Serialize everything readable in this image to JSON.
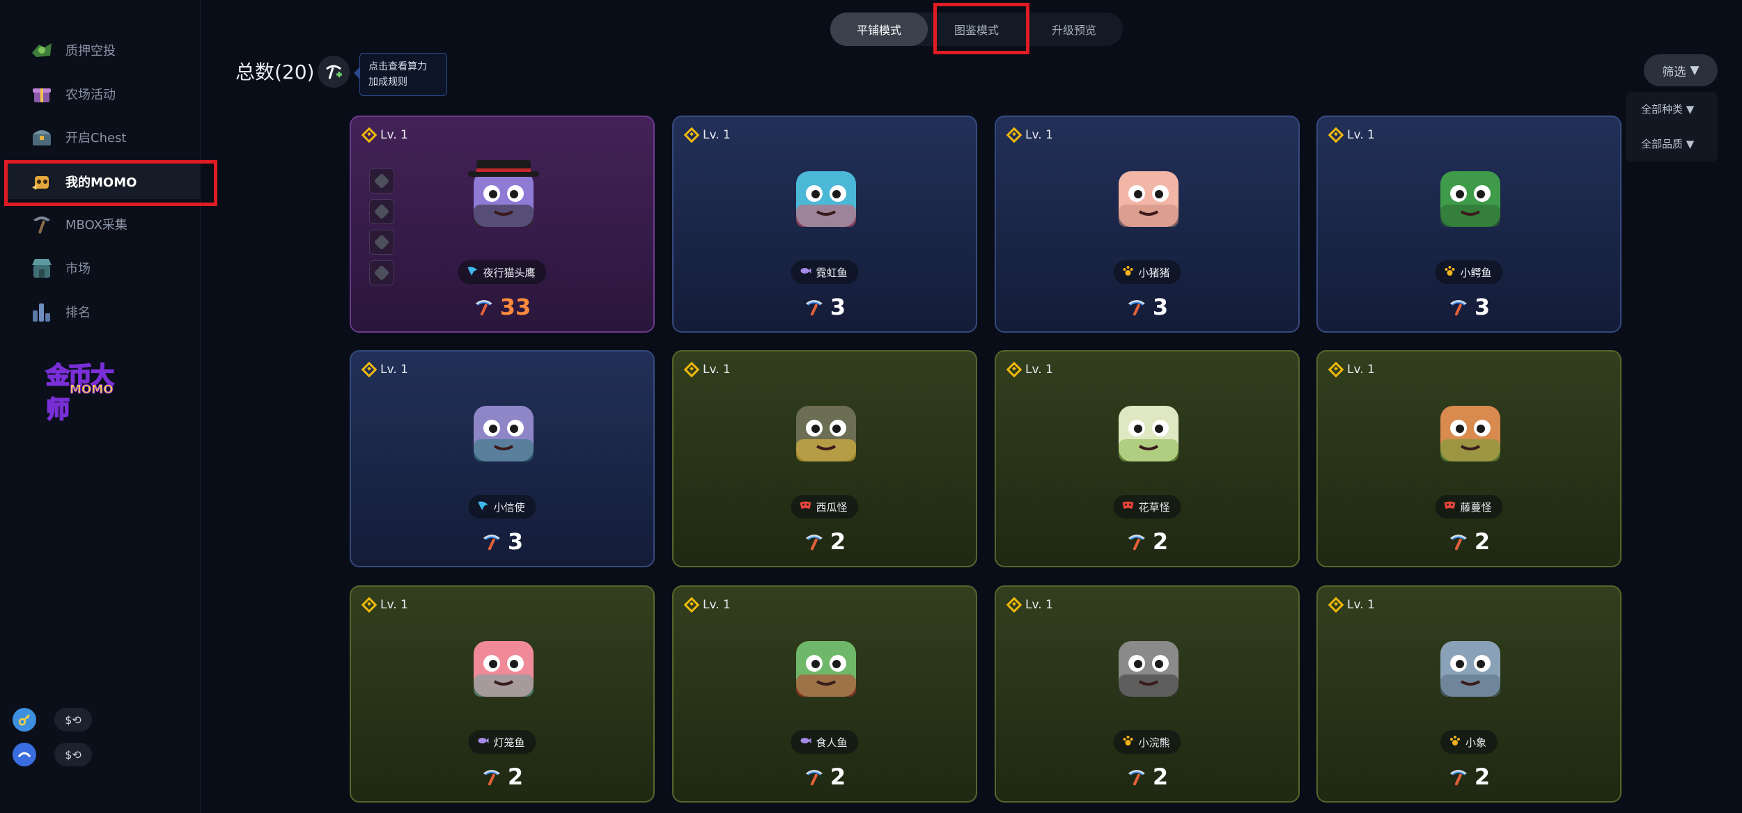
{
  "sidebar": {
    "items": [
      {
        "label": "质押空投",
        "icon": "stake-airdrop-icon"
      },
      {
        "label": "农场活动",
        "icon": "farm-gift-icon"
      },
      {
        "label": "开启Chest",
        "icon": "chest-icon"
      },
      {
        "label": "我的MOMO",
        "icon": "my-momo-icon",
        "active": true
      },
      {
        "label": "MBOX采集",
        "icon": "pickaxe-icon"
      },
      {
        "label": "市场",
        "icon": "market-icon"
      },
      {
        "label": "排名",
        "icon": "ranking-icon"
      }
    ],
    "logo": {
      "line1": "金币大师",
      "line2": "MOMO"
    },
    "wallets": [
      {
        "icon": "key-token-icon",
        "value": "$"
      },
      {
        "icon": "mbox-token-icon",
        "value": "$"
      }
    ]
  },
  "mode_tabs": [
    {
      "label": "平铺模式",
      "selected": true
    },
    {
      "label": "图鉴模式",
      "selected": false
    },
    {
      "label": "升级预览",
      "selected": false
    }
  ],
  "total": "总数(20)",
  "tooltip": {
    "line1": "点击查看算力",
    "line2": "加成规则"
  },
  "filter": {
    "label": "筛选",
    "options": [
      "全部种类",
      "全部品质"
    ]
  },
  "colors": {
    "highlight": "#e01b23",
    "bnb": "#f0b90b",
    "power_orange": "#ff8a3d"
  },
  "cards": [
    {
      "level": "Lv. 1",
      "name": "夜行猫头鹰",
      "type_icon": "wing-icon",
      "power": "33",
      "rarity": "purple"
    },
    {
      "level": "Lv. 1",
      "name": "霓虹鱼",
      "type_icon": "fish-icon",
      "power": "3",
      "rarity": "blue"
    },
    {
      "level": "Lv. 1",
      "name": "小猪猪",
      "type_icon": "paw-icon",
      "power": "3",
      "rarity": "blue"
    },
    {
      "level": "Lv. 1",
      "name": "小鳄鱼",
      "type_icon": "paw-icon",
      "power": "3",
      "rarity": "blue"
    },
    {
      "level": "Lv. 1",
      "name": "小信使",
      "type_icon": "wing-icon",
      "power": "3",
      "rarity": "blue"
    },
    {
      "level": "Lv. 1",
      "name": "西瓜怪",
      "type_icon": "mask-icon",
      "power": "2",
      "rarity": "green"
    },
    {
      "level": "Lv. 1",
      "name": "花草怪",
      "type_icon": "mask-icon",
      "power": "2",
      "rarity": "green"
    },
    {
      "level": "Lv. 1",
      "name": "藤蔓怪",
      "type_icon": "mask-icon",
      "power": "2",
      "rarity": "green"
    },
    {
      "level": "Lv. 1",
      "name": "灯笼鱼",
      "type_icon": "fish-icon",
      "power": "2",
      "rarity": "green"
    },
    {
      "level": "Lv. 1",
      "name": "食人鱼",
      "type_icon": "fish-icon",
      "power": "2",
      "rarity": "green"
    },
    {
      "level": "Lv. 1",
      "name": "小浣熊",
      "type_icon": "paw-icon",
      "power": "2",
      "rarity": "green"
    },
    {
      "level": "Lv. 1",
      "name": "小象",
      "type_icon": "paw-icon",
      "power": "2",
      "rarity": "green"
    }
  ]
}
